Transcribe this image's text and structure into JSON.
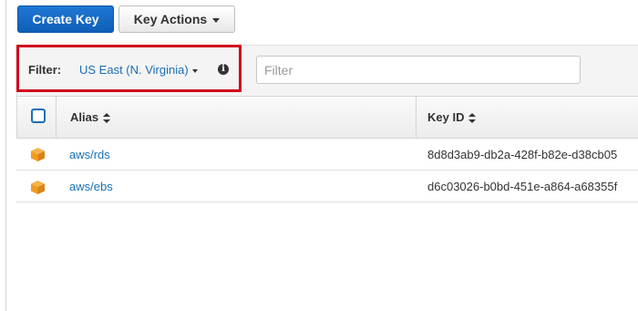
{
  "toolbar": {
    "create_key_label": "Create Key",
    "key_actions_label": "Key Actions"
  },
  "filter": {
    "label": "Filter:",
    "region": "US East (N. Virginia)",
    "info": "i",
    "placeholder": "Filter",
    "value": ""
  },
  "table": {
    "headers": {
      "alias": "Alias",
      "key_id": "Key ID"
    },
    "rows": [
      {
        "alias": "aws/rds",
        "key_id": "8d8d3ab9-db2a-428f-b82e-d38cb05",
        "icon": "aws-box-icon"
      },
      {
        "alias": "aws/ebs",
        "key_id": "d6c03026-b0bd-451e-a864-a68355f",
        "icon": "aws-box-icon"
      }
    ]
  },
  "colors": {
    "primary": "#1f77d4",
    "link": "#1a6fb5",
    "highlight": "#d0021b",
    "icon": "#f29b1d"
  }
}
